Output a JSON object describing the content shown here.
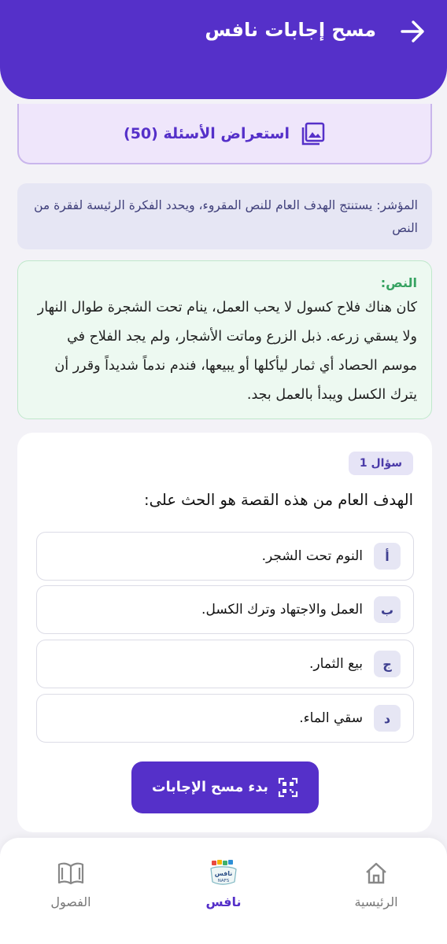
{
  "header": {
    "title": "مسح إجابات نافس",
    "back_icon": "arrow-right-icon"
  },
  "preview": {
    "label": "استعراض الأسئلة (50)",
    "icon": "image-gallery-icon"
  },
  "indicator": {
    "label": "المؤشر:",
    "text": " يستنتج الهدف العام للنص المقروء، ويحدد الفكرة الرئيسة لفقرة من النص"
  },
  "passage": {
    "label": "النص:",
    "text": "كان هناك فلاح كسول لا يحب العمل، ينام تحت الشجرة طوال النهار ولا يسقي زرعه. ذبل الزرع وماتت الأشجار، ولم يجد الفلاح في موسم الحصاد أي ثمار ليأكلها أو يبيعها، فندم ندماً شديداً وقرر أن يترك الكسل ويبدأ بالعمل بجد."
  },
  "question": {
    "badge": "سؤال 1",
    "text": "الهدف العام من هذه القصة هو الحث على:",
    "options": [
      {
        "letter": "أ",
        "text": "النوم تحت الشجر."
      },
      {
        "letter": "ب",
        "text": "العمل والاجتهاد وترك الكسل."
      },
      {
        "letter": "ج",
        "text": "بيع الثمار."
      },
      {
        "letter": "د",
        "text": "سقي الماء."
      }
    ]
  },
  "scan_button": {
    "label": "بدء مسح الإجابات",
    "icon": "qr-scan-icon"
  },
  "nav": {
    "items": [
      {
        "label": "الرئيسية",
        "icon": "home-icon"
      },
      {
        "label": "نافس",
        "icon": "nafs-logo-icon"
      },
      {
        "label": "الفصول",
        "icon": "book-icon"
      }
    ]
  },
  "colors": {
    "primary": "#5530c9",
    "passage_label": "#37a362",
    "indicator_bg": "#e6e6f4"
  }
}
